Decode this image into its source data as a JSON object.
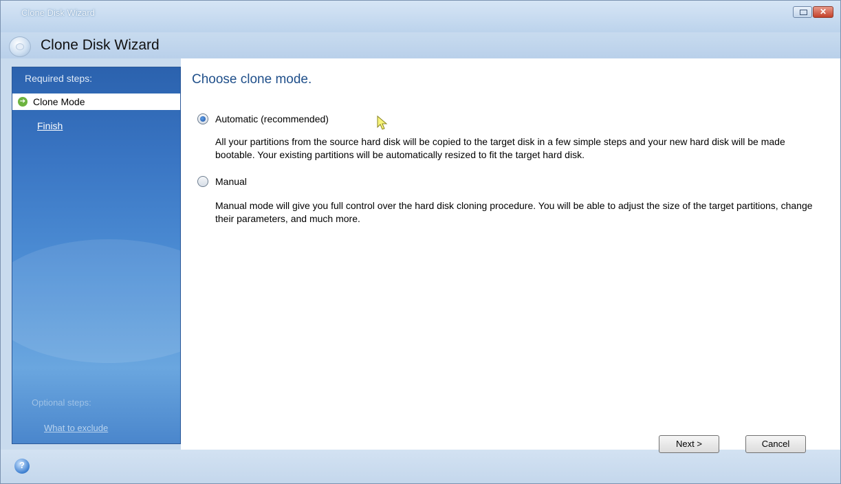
{
  "window": {
    "title": "Clone Disk Wizard",
    "header_title": "Clone Disk Wizard",
    "close_glyph": "✕"
  },
  "sidebar": {
    "required_label": "Required steps:",
    "steps": [
      {
        "label": "Clone Mode",
        "active": true
      },
      {
        "label": "Finish",
        "active": false
      }
    ],
    "optional_label": "Optional steps:",
    "optional_steps": [
      {
        "label": "What to exclude"
      }
    ]
  },
  "content": {
    "title": "Choose clone mode.",
    "options": [
      {
        "label": "Automatic (recommended)",
        "selected": true,
        "description": "All your partitions from the source hard disk will be copied to the target disk in a few simple steps and your new hard disk will be made bootable. Your existing partitions will be automatically resized to fit the target hard disk."
      },
      {
        "label": "Manual",
        "selected": false,
        "description": "Manual mode will give you full control over the hard disk cloning procedure. You will be able to adjust the size of the target partitions, change their parameters, and much more."
      }
    ]
  },
  "buttons": {
    "next": "Next >",
    "cancel": "Cancel"
  },
  "colors": {
    "sidebar_blue": "#3a76c4",
    "title_blue": "#1f4f8a",
    "step_arrow_green": "#6cb33f"
  }
}
